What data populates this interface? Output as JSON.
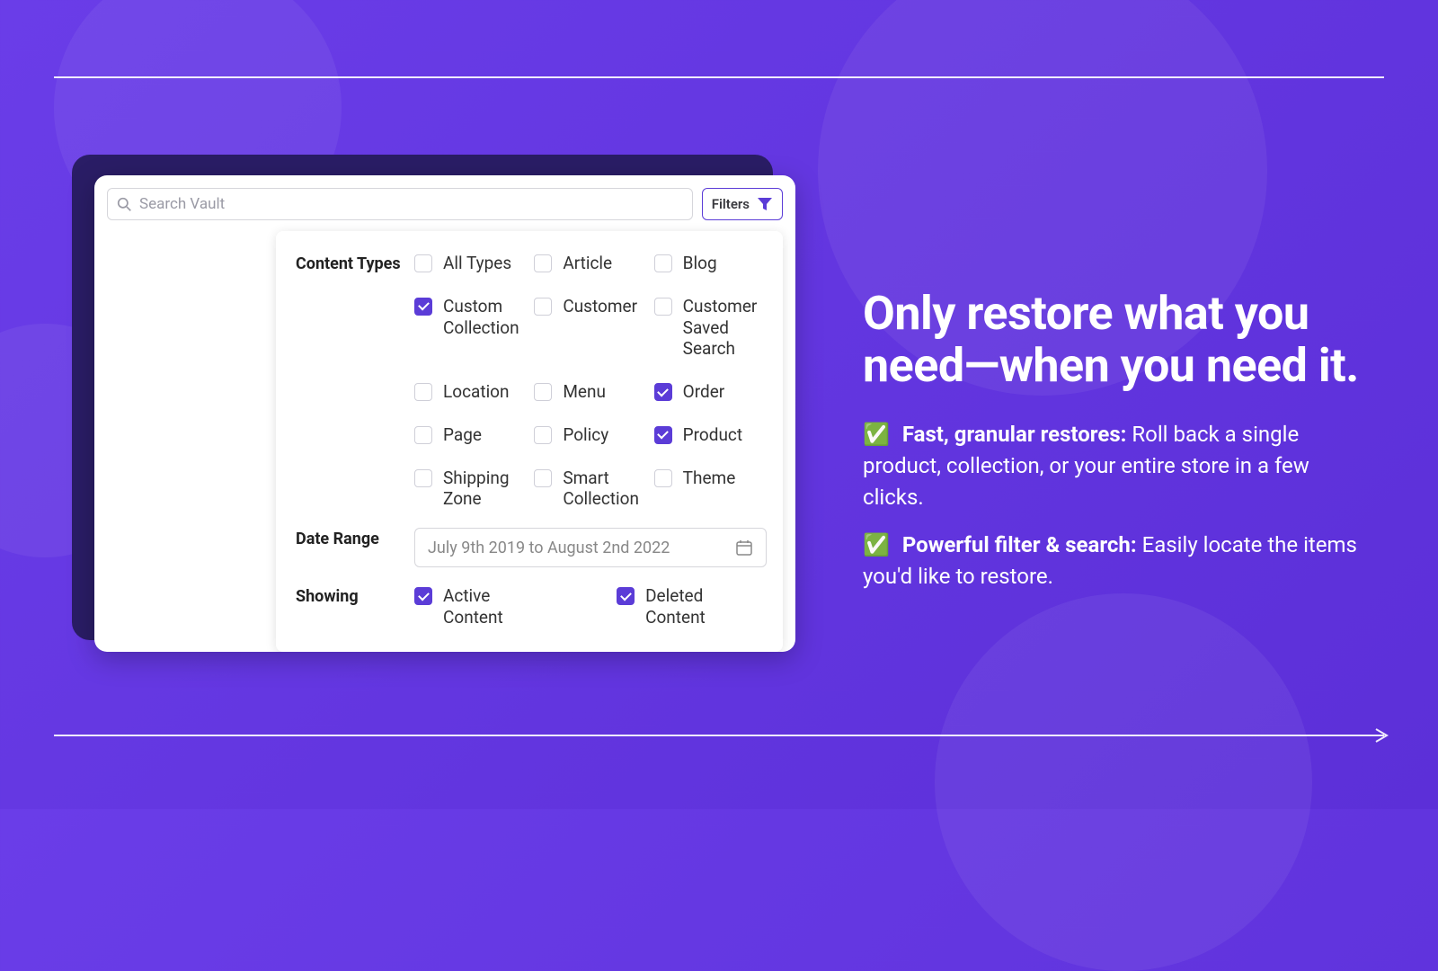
{
  "search": {
    "placeholder": "Search Vault",
    "filters_label": "Filters"
  },
  "sections": {
    "content_types_label": "Content Types",
    "date_range_label": "Date Range",
    "showing_label": "Showing"
  },
  "content_types": [
    {
      "label": "All Types",
      "checked": false
    },
    {
      "label": "Article",
      "checked": false
    },
    {
      "label": "Blog",
      "checked": false
    },
    {
      "label": "Custom Collection",
      "checked": true
    },
    {
      "label": "Customer",
      "checked": false
    },
    {
      "label": "Customer Saved Search",
      "checked": false
    },
    {
      "label": "Location",
      "checked": false
    },
    {
      "label": "Menu",
      "checked": false
    },
    {
      "label": "Order",
      "checked": true
    },
    {
      "label": "Page",
      "checked": false
    },
    {
      "label": "Policy",
      "checked": false
    },
    {
      "label": "Product",
      "checked": true
    },
    {
      "label": "Shipping Zone",
      "checked": false
    },
    {
      "label": "Smart Collection",
      "checked": false
    },
    {
      "label": "Theme",
      "checked": false
    }
  ],
  "date_range": {
    "value": "July 9th 2019 to August 2nd 2022"
  },
  "showing": [
    {
      "label": "Active Content",
      "checked": true
    },
    {
      "label": "Deleted Content",
      "checked": true
    }
  ],
  "copy": {
    "headline": "Only restore what you need—when you need it.",
    "bullets": [
      {
        "strong": "Fast, granular restores:",
        "rest": " Roll back a single product, collection, or your entire store in a few clicks."
      },
      {
        "strong": "Powerful filter & search:",
        "rest": " Easily locate the items you'd like to restore."
      }
    ]
  },
  "icons": {
    "check_emoji": "✅"
  }
}
